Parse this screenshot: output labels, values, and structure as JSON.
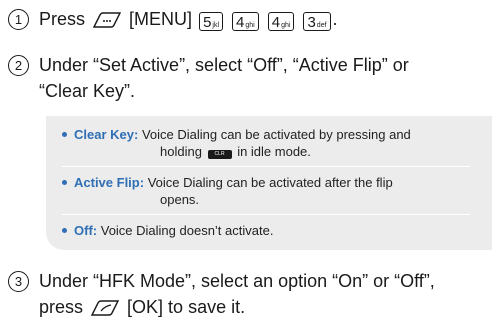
{
  "steps": [
    {
      "number": "1",
      "before": "Press",
      "menu_label": "[MENU]",
      "keys": [
        {
          "digit": "5",
          "letters": "jkl"
        },
        {
          "digit": "4",
          "letters": "ghi"
        },
        {
          "digit": "4",
          "letters": "ghi"
        },
        {
          "digit": "3",
          "letters": "def"
        }
      ],
      "after": "."
    },
    {
      "number": "2",
      "line1": "Under “Set Active”, select “Off”, “Active Flip” or",
      "line2": "“Clear Key”."
    },
    {
      "number": "3",
      "line1": "Under “HFK Mode”, select an option “On” or “Off”,",
      "line2_before": "press",
      "line2_after": "[OK] to save it."
    }
  ],
  "notes": [
    {
      "term": "Clear Key:",
      "line1": "Voice Dialing can be activated by pressing and",
      "line2_before": "holding",
      "key_icon_text": "CLR",
      "line2_after": "in idle mode."
    },
    {
      "term": "Active Flip:",
      "line1": "Voice Dialing can be activated after the flip",
      "line2": "opens."
    },
    {
      "term": "Off:",
      "line1": "Voice Dialing doesn’t activate."
    }
  ],
  "colors": {
    "accent": "#2f6fb5",
    "note_bg": "#ececec",
    "text": "#1a1a1a"
  },
  "icons": {
    "soft_key": "soft-key-icon",
    "clear_key": "clear-key-icon"
  }
}
